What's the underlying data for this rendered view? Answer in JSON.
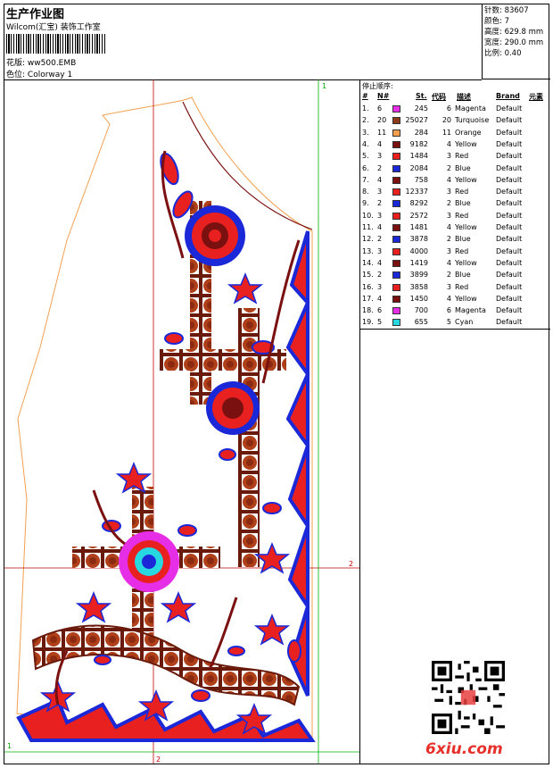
{
  "header": {
    "title": "生产作业图",
    "company": "Wilcom(汇宝) 装饰工作室",
    "pattern_label": "花版:",
    "pattern_value": "ww500.EMB",
    "color_label": "色位:",
    "color_value": "Colorway 1"
  },
  "stats": {
    "stitches": "针数: 83607",
    "colors": "颜色: 7",
    "height": "高度: 629.8 mm",
    "width": "宽度: 290.0 mm",
    "scale": "比例: 0.40"
  },
  "legend": {
    "title": "停止顺序:",
    "headers": {
      "num": "#",
      "needle": "N#",
      "stitches": "St.",
      "code": "代码",
      "desc": "描述",
      "brand": "Brand",
      "element": "元素"
    },
    "rows": [
      {
        "num": "1.",
        "needle": "6",
        "color": "#e62ee6",
        "stitches": "245",
        "code": "6",
        "desc": "Magenta",
        "brand": "Default"
      },
      {
        "num": "2.",
        "needle": "20",
        "color": "#8b3a1a",
        "stitches": "25027",
        "code": "20",
        "desc": "Turquoise",
        "brand": "Default"
      },
      {
        "num": "3.",
        "needle": "11",
        "color": "#f2a050",
        "stitches": "284",
        "code": "11",
        "desc": "Orange",
        "brand": "Default"
      },
      {
        "num": "4.",
        "needle": "4",
        "color": "#7a1010",
        "stitches": "9182",
        "code": "4",
        "desc": "Yellow",
        "brand": "Default"
      },
      {
        "num": "5.",
        "needle": "3",
        "color": "#e82020",
        "stitches": "1484",
        "code": "3",
        "desc": "Red",
        "brand": "Default"
      },
      {
        "num": "6.",
        "needle": "2",
        "color": "#1a28d8",
        "stitches": "2084",
        "code": "2",
        "desc": "Blue",
        "brand": "Default"
      },
      {
        "num": "7.",
        "needle": "4",
        "color": "#7a1010",
        "stitches": "758",
        "code": "4",
        "desc": "Yellow",
        "brand": "Default"
      },
      {
        "num": "8.",
        "needle": "3",
        "color": "#e82020",
        "stitches": "12337",
        "code": "3",
        "desc": "Red",
        "brand": "Default"
      },
      {
        "num": "9.",
        "needle": "2",
        "color": "#1a28d8",
        "stitches": "8292",
        "code": "2",
        "desc": "Blue",
        "brand": "Default"
      },
      {
        "num": "10.",
        "needle": "3",
        "color": "#e82020",
        "stitches": "2572",
        "code": "3",
        "desc": "Red",
        "brand": "Default"
      },
      {
        "num": "11.",
        "needle": "4",
        "color": "#7a1010",
        "stitches": "1481",
        "code": "4",
        "desc": "Yellow",
        "brand": "Default"
      },
      {
        "num": "12.",
        "needle": "2",
        "color": "#1a28d8",
        "stitches": "3878",
        "code": "2",
        "desc": "Blue",
        "brand": "Default"
      },
      {
        "num": "13.",
        "needle": "3",
        "color": "#e82020",
        "stitches": "4000",
        "code": "3",
        "desc": "Red",
        "brand": "Default"
      },
      {
        "num": "14.",
        "needle": "4",
        "color": "#7a1010",
        "stitches": "1419",
        "code": "4",
        "desc": "Yellow",
        "brand": "Default"
      },
      {
        "num": "15.",
        "needle": "2",
        "color": "#1a28d8",
        "stitches": "3899",
        "code": "2",
        "desc": "Blue",
        "brand": "Default"
      },
      {
        "num": "16.",
        "needle": "3",
        "color": "#e82020",
        "stitches": "3858",
        "code": "3",
        "desc": "Red",
        "brand": "Default"
      },
      {
        "num": "17.",
        "needle": "4",
        "color": "#7a1010",
        "stitches": "1450",
        "code": "4",
        "desc": "Yellow",
        "brand": "Default"
      },
      {
        "num": "18.",
        "needle": "6",
        "color": "#e62ee6",
        "stitches": "700",
        "code": "6",
        "desc": "Magenta",
        "brand": "Default"
      },
      {
        "num": "19.",
        "needle": "5",
        "color": "#28d8e0",
        "stitches": "655",
        "code": "5",
        "desc": "Cyan",
        "brand": "Default"
      }
    ]
  },
  "guides": {
    "h_top": "1",
    "h_right": "2",
    "v_bottom": "2",
    "corner_left": "1"
  },
  "watermark": "6xiu.com",
  "colors": {
    "red": "#e82020",
    "blue": "#1a28d8",
    "brown": "#8b3a1a",
    "dark": "#7a1010",
    "magenta": "#e62ee6",
    "cyan": "#28d8e0",
    "orange": "#f2a050",
    "guide_red": "#c00000",
    "guide_green": "#00b000"
  }
}
